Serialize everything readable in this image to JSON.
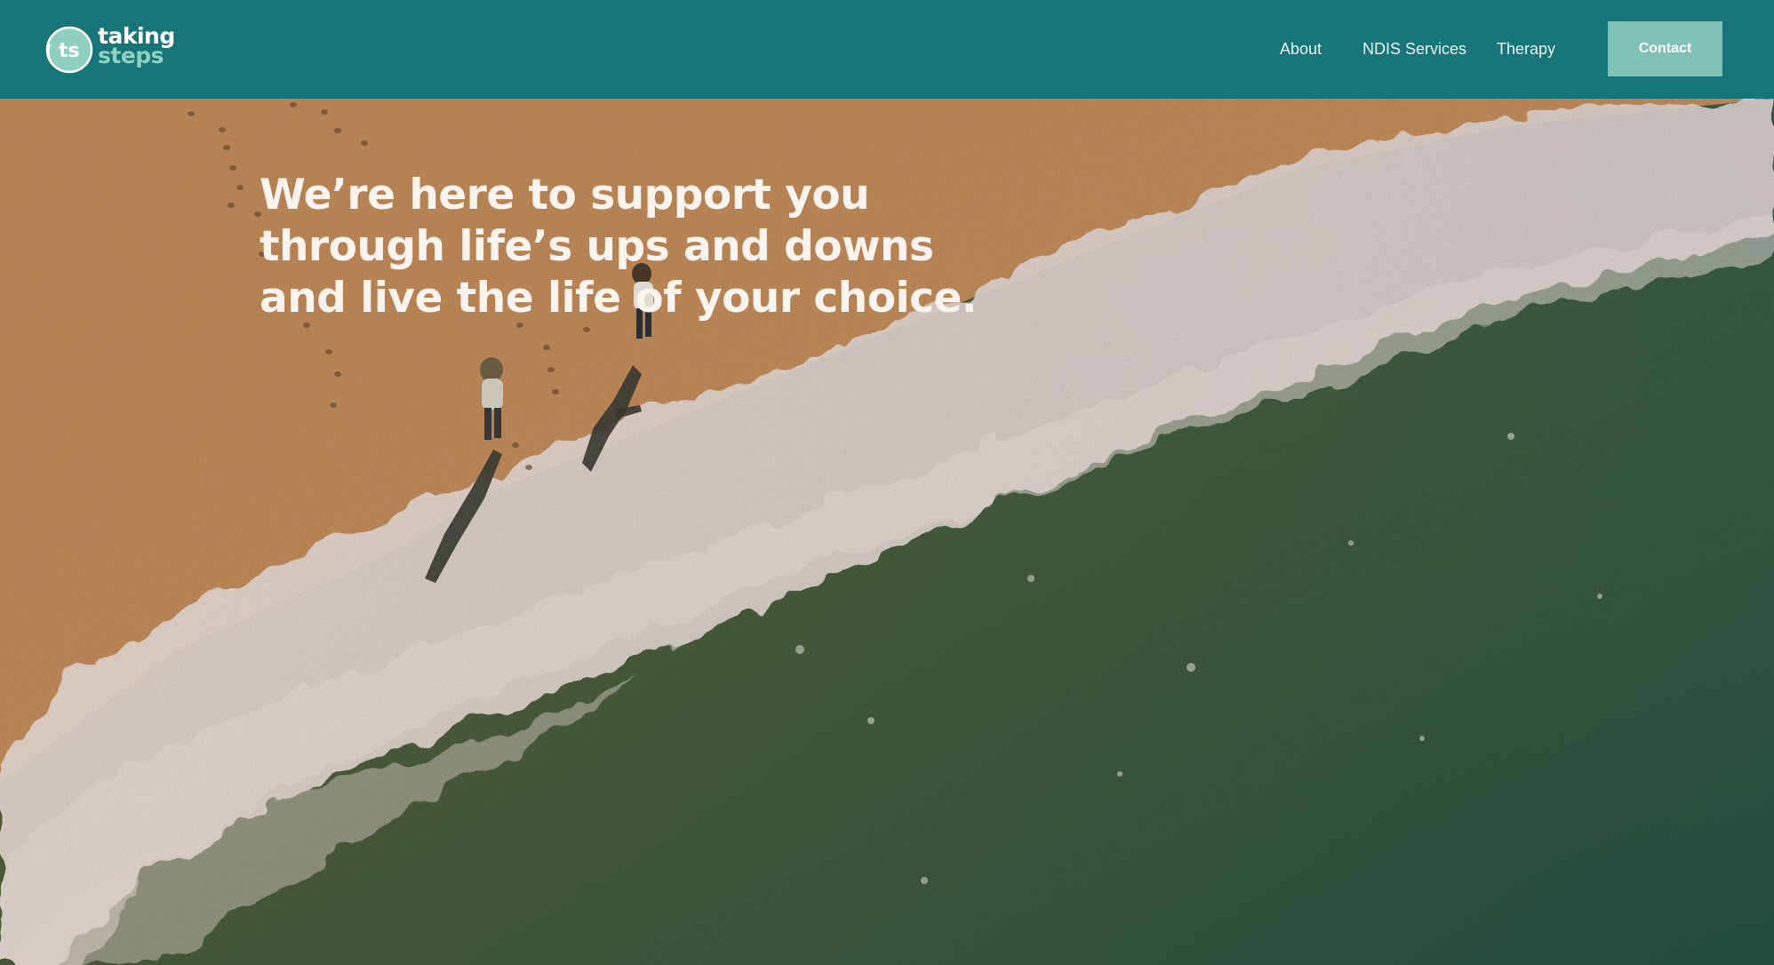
{
  "brand": {
    "monogram": "ts",
    "word1": "taking",
    "word2": "steps",
    "colors": {
      "header": "#177479",
      "accent": "#7fc1b3",
      "brand_light": "#8fd0c0"
    }
  },
  "nav": {
    "items": [
      {
        "label": "About"
      },
      {
        "label": "NDIS Services"
      },
      {
        "label": "Therapy"
      }
    ],
    "contact_label": "Contact"
  },
  "hero": {
    "headline_lines": [
      "We’re here to support you",
      "through life’s ups and downs",
      "and live the life of your choice."
    ],
    "image_description_icon": "beach-photo"
  }
}
